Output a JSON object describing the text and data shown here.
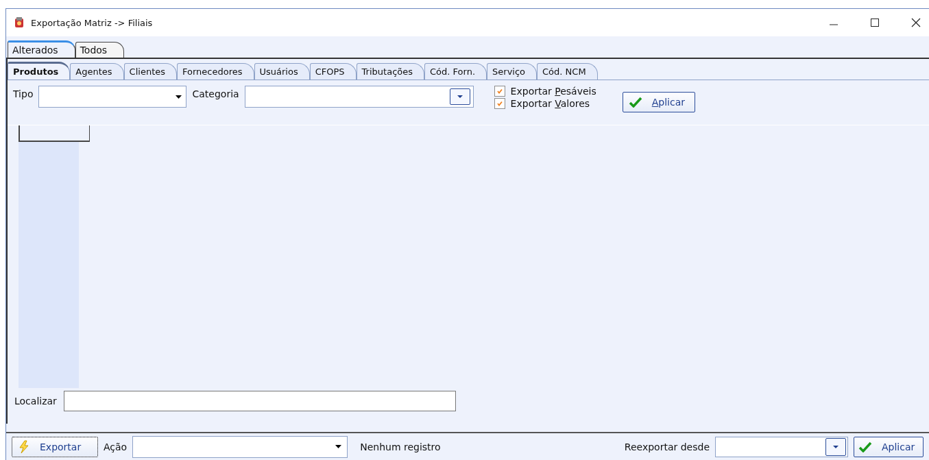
{
  "window": {
    "title": "Exportação Matriz -> Filiais"
  },
  "outer_tabs": [
    {
      "label": "Alterados",
      "selected": true
    },
    {
      "label": "Todos",
      "selected": false
    }
  ],
  "tabs": [
    {
      "label": "Produtos",
      "selected": true
    },
    {
      "label": "Agentes",
      "selected": false
    },
    {
      "label": "Clientes",
      "selected": false
    },
    {
      "label": "Fornecedores",
      "selected": false
    },
    {
      "label": "Usuários",
      "selected": false
    },
    {
      "label": "CFOPS",
      "selected": false
    },
    {
      "label": "Tributações",
      "selected": false
    },
    {
      "label": "Cód. Forn.",
      "selected": false
    },
    {
      "label": "Serviço",
      "selected": false
    },
    {
      "label": "Cód. NCM",
      "selected": false
    }
  ],
  "filters": {
    "tipo_label": "Tipo",
    "categoria_label": "Categoria",
    "checkboxes": [
      {
        "prefix": "Exportar ",
        "mnemonic": "P",
        "rest": "esáveis",
        "checked": true
      },
      {
        "prefix": "Exportar ",
        "mnemonic": "V",
        "rest": "alores",
        "checked": true
      }
    ],
    "apply_button": {
      "mnemonic": "A",
      "rest": "plicar"
    }
  },
  "search": {
    "label": "Localizar"
  },
  "footer": {
    "export_button": "Exportar",
    "action_label": "Ação",
    "status": "Nenhum registro",
    "reexport_label": "Reexportar desde",
    "apply_button": "Aplicar"
  }
}
